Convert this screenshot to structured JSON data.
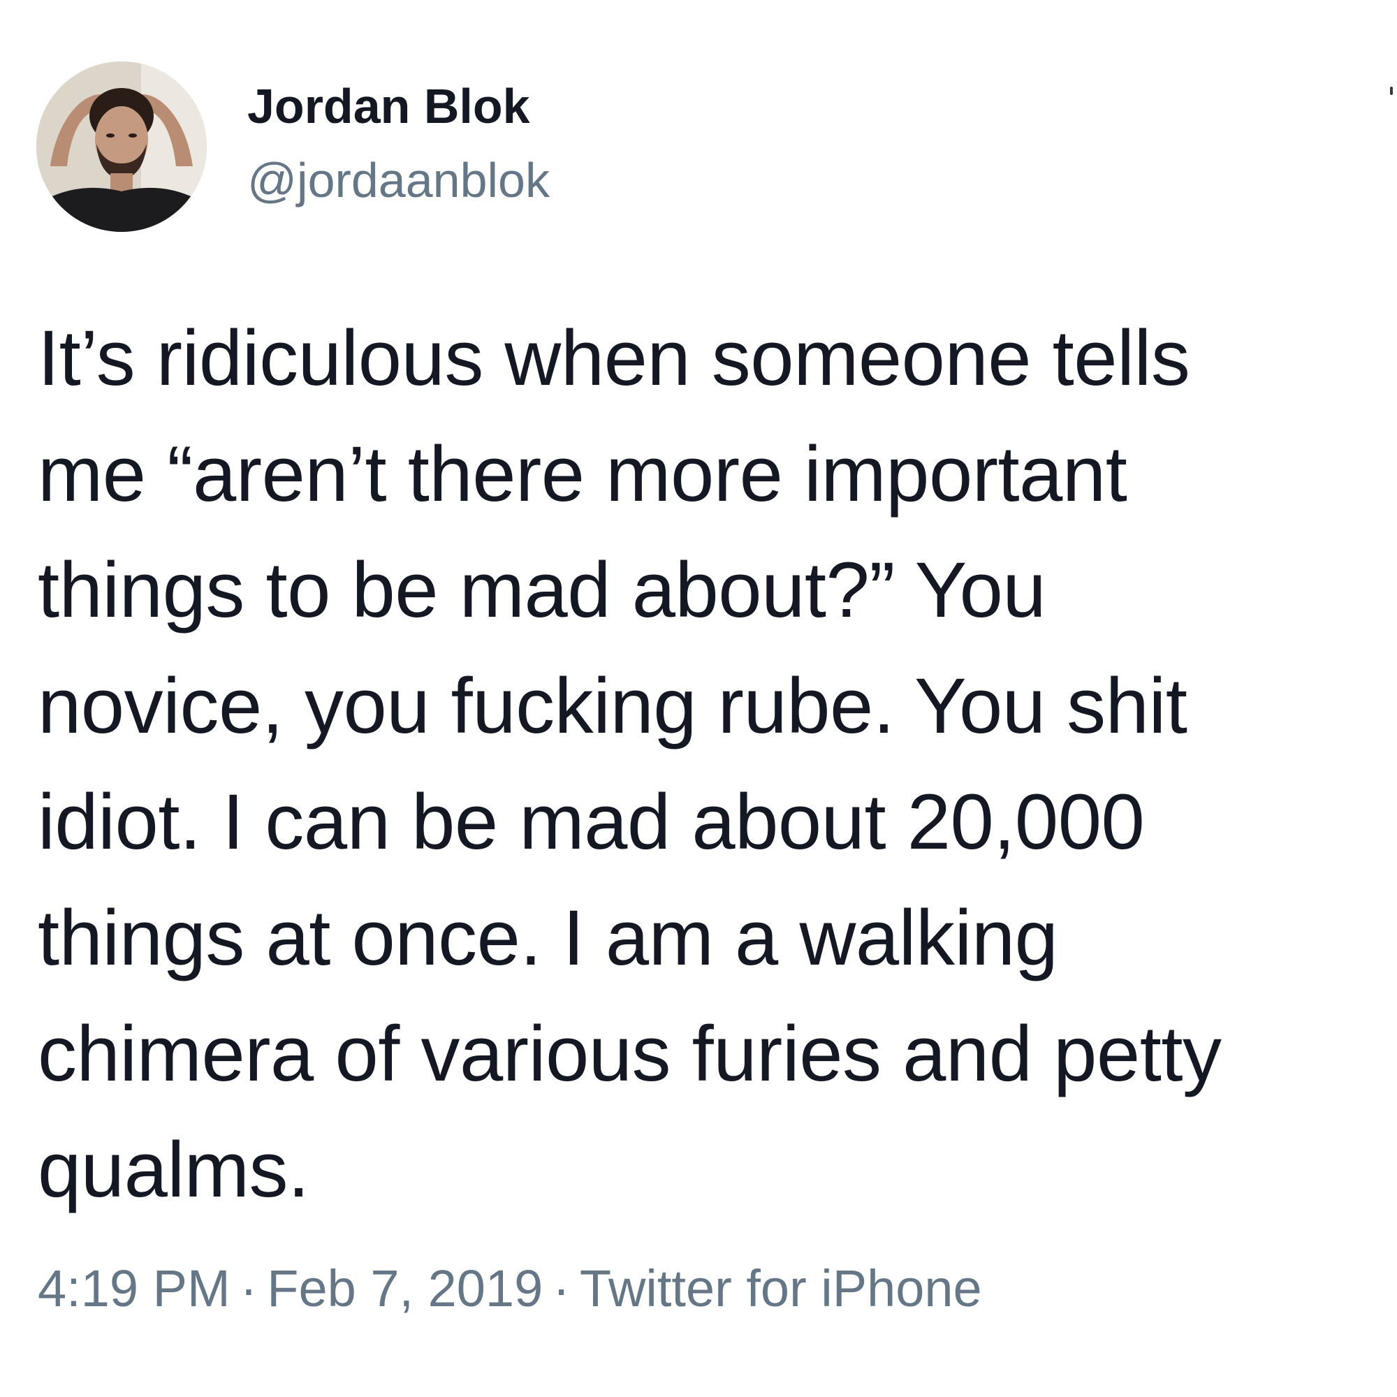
{
  "tweet": {
    "author": {
      "display_name": "Jordan Blok",
      "handle": "@jordaanblok",
      "avatar_icon": "profile-photo"
    },
    "text_lines": [
      "It’s ridiculous when someone tells",
      "me “aren’t there more important",
      "things to be mad about?” You",
      "novice, you fucking rube. You shit",
      "idiot. I can be mad about 20,000",
      "things at once. I am a walking",
      "chimera of various furies and petty",
      "qualms."
    ],
    "meta": {
      "time": "4:19 PM",
      "separator": "·",
      "date": "Feb 7, 2019",
      "source": "Twitter for iPhone"
    }
  },
  "colors": {
    "text": "#141823",
    "secondary": "#657786",
    "background": "#ffffff"
  }
}
